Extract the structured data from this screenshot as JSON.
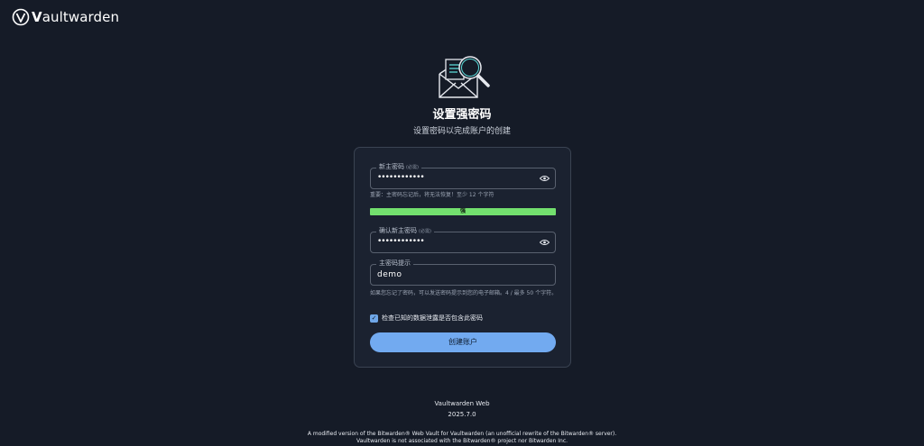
{
  "brand": {
    "name_bold": "V",
    "name_rest": "aultwarden"
  },
  "header": {
    "title": "设置强密码",
    "subtitle": "设置密码以完成账户的创建"
  },
  "form": {
    "new_password": {
      "label": "新主密码",
      "required": "(必需)",
      "value": "••••••••••••",
      "help": "重要：主密码忘记后，将无法恢复！至少 12 个字符"
    },
    "strength": {
      "label": "强",
      "level": 1.0
    },
    "confirm_password": {
      "label": "确认新主密码",
      "required": "(必需)",
      "value": "••••••••••••"
    },
    "hint": {
      "label": "主密码提示",
      "value": "demo",
      "help": "如果您忘记了密码，可以发送密码提示到您的电子邮箱。4 / 最多 50 个字符。"
    },
    "breach_check": {
      "label": "检查已知的数据泄露是否包含此密码",
      "checked": true
    },
    "submit_label": "创建账户"
  },
  "footer": {
    "app_name": "Vaultwarden Web",
    "version": "2025.7.0",
    "disclaimer_line1": "A modified version of the Bitwarden® Web Vault for Vaultwarden (an unofficial rewrite of the Bitwarden® server).",
    "disclaimer_line2": "Vaultwarden is not associated with the Bitwarden® project nor Bitwarden Inc."
  },
  "colors": {
    "background": "#151b27",
    "card": "#1b2230",
    "accent": "#72aaf0",
    "strength_strong": "#73e06e"
  }
}
